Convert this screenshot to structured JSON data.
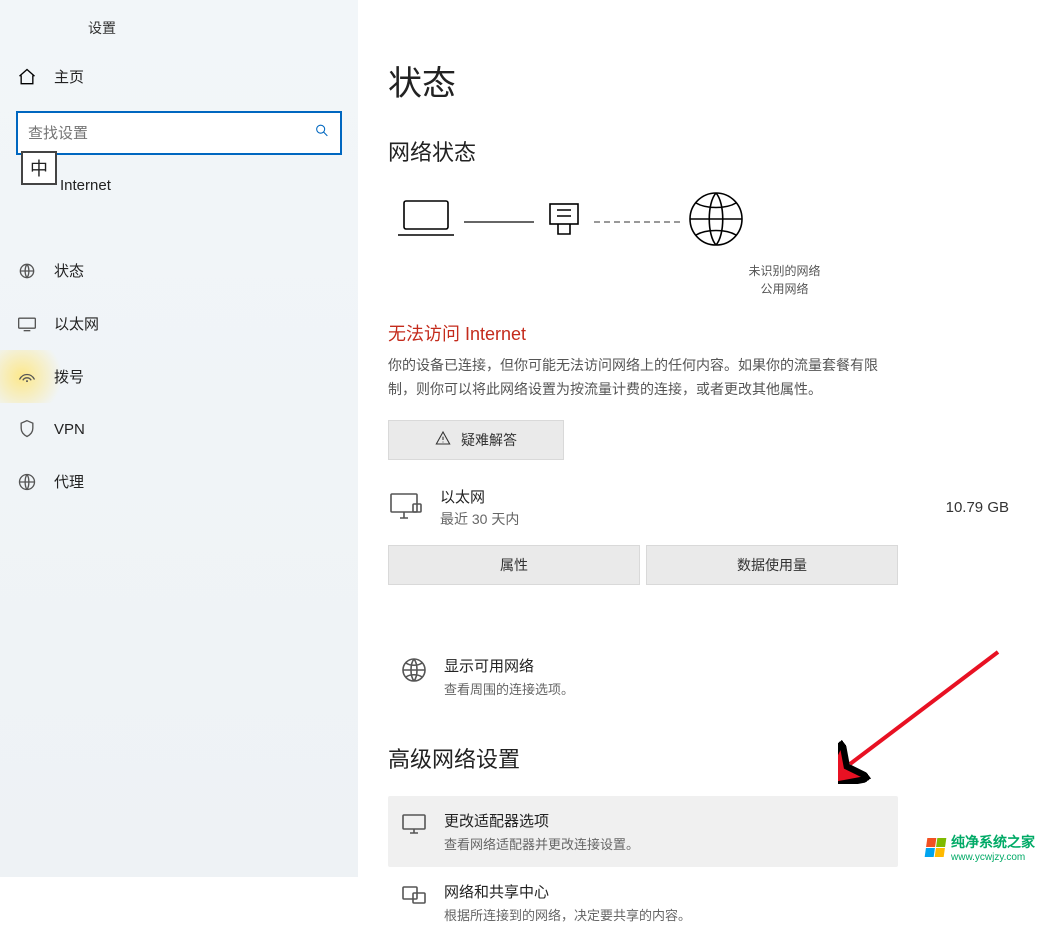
{
  "app": {
    "title": "设置"
  },
  "sidebar": {
    "home_label": "主页",
    "search_placeholder": "查找设置",
    "ime_badge": "中",
    "category_label": "Internet",
    "items": [
      {
        "label": "状态"
      },
      {
        "label": "以太网"
      },
      {
        "label": "拨号"
      },
      {
        "label": "VPN"
      },
      {
        "label": "代理"
      }
    ]
  },
  "main": {
    "page_title": "状态",
    "network_status_heading": "网络状态",
    "diagram": {
      "caption_line1": "未识别的网络",
      "caption_line2": "公用网络"
    },
    "error": {
      "title": "无法访问 Internet",
      "body": "你的设备已连接，但你可能无法访问网络上的任何内容。如果你的流量套餐有限制，则你可以将此网络设置为按流量计费的连接，或者更改其他属性。"
    },
    "troubleshoot_button": "疑难解答",
    "ethernet": {
      "name": "以太网",
      "subtitle": "最近 30 天内",
      "usage": "10.79 GB"
    },
    "buttons": {
      "properties": "属性",
      "data_usage": "数据使用量"
    },
    "show_networks": {
      "title": "显示可用网络",
      "subtitle": "查看周围的连接选项。"
    },
    "advanced_heading": "高级网络设置",
    "adapter_options": {
      "title": "更改适配器选项",
      "subtitle": "查看网络适配器并更改连接设置。"
    },
    "sharing_center": {
      "title": "网络和共享中心",
      "subtitle": "根据所连接到的网络，决定要共享的内容。"
    }
  },
  "watermark": {
    "name": "纯净系统之家",
    "url": "www.ycwjzy.com"
  }
}
